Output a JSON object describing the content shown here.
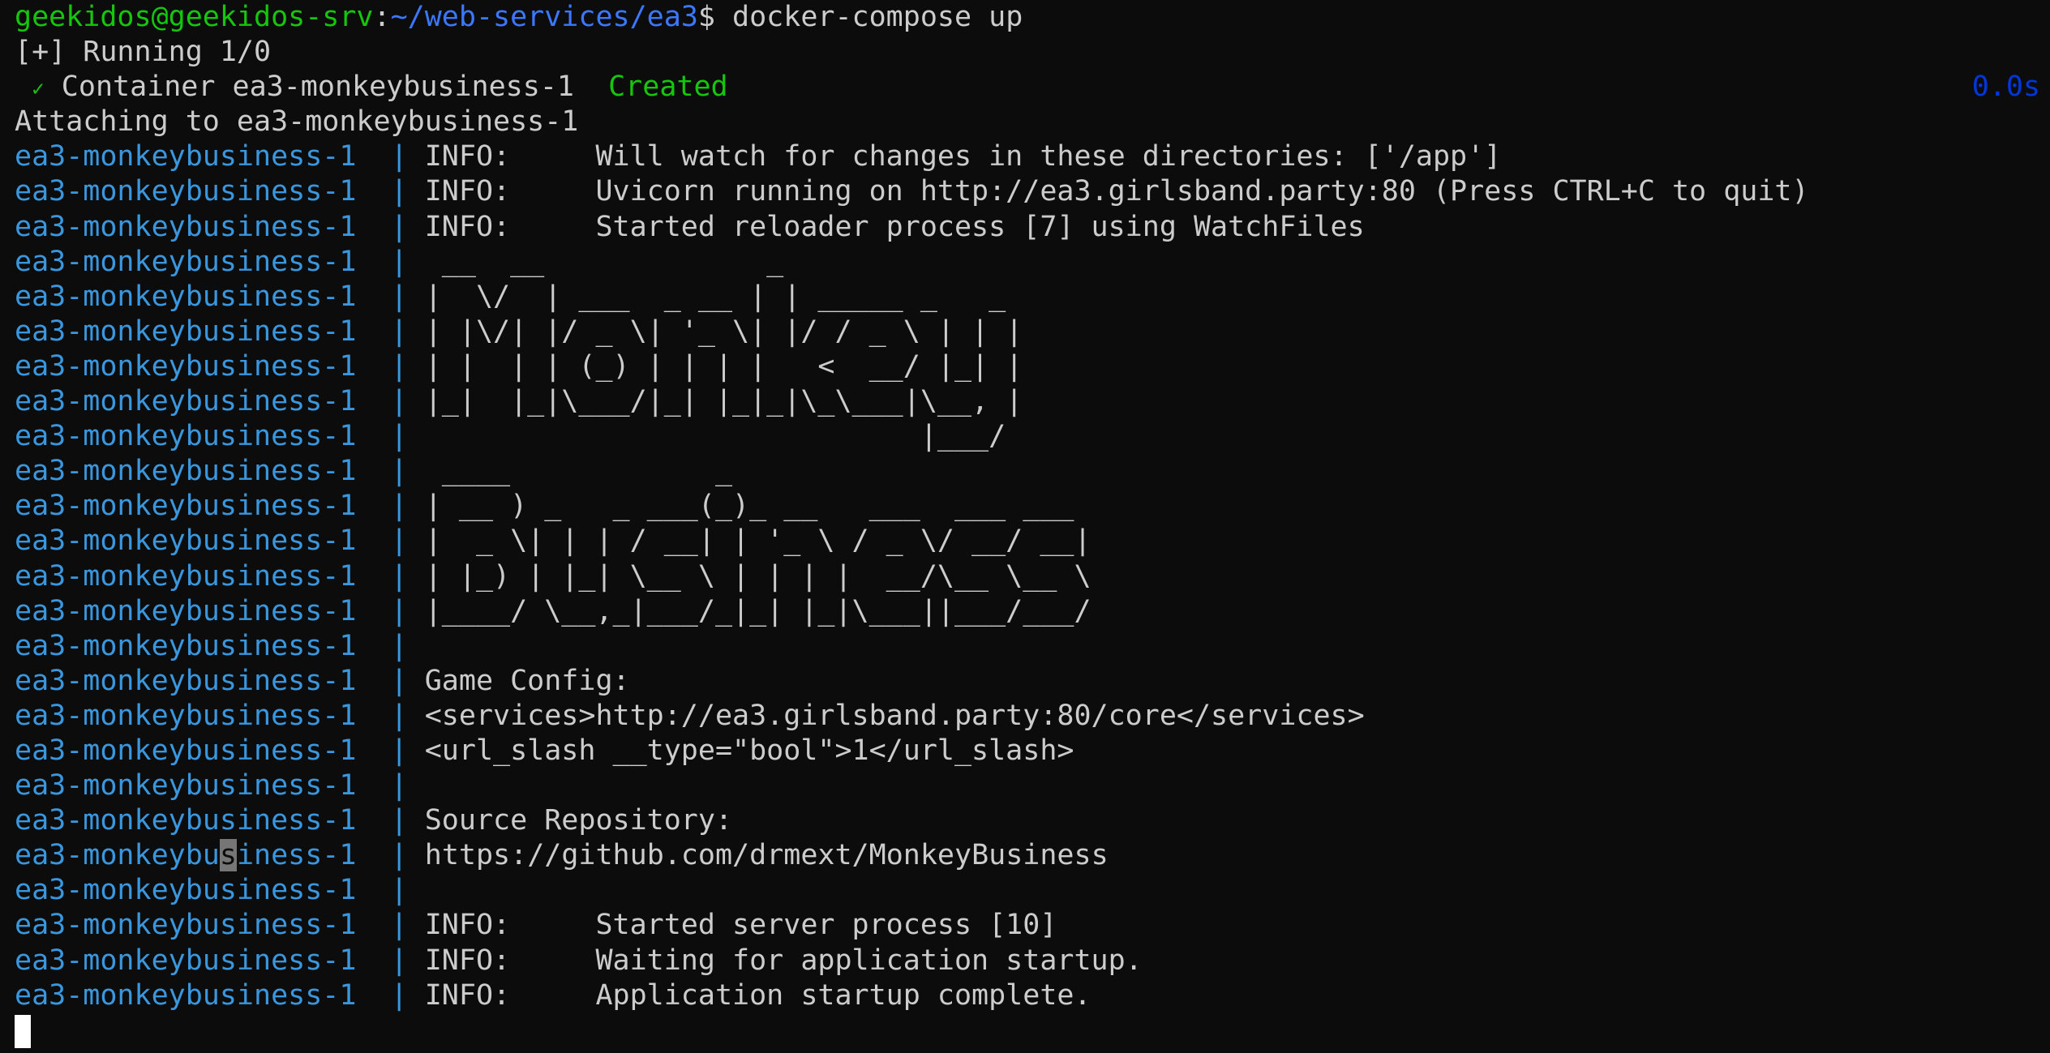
{
  "prompt": {
    "user_host": "geekidos@geekidos-srv",
    "separator": ":",
    "path": "~/web-services/ea3",
    "symbol": "$",
    "command": " docker-compose up"
  },
  "compose": {
    "running": "[+] Running 1/0",
    "check_glyph": "✓",
    "container_text": " Container ea3-monkeybusiness-1  ",
    "container_status": "Created",
    "duration": "0.0s",
    "attaching": "Attaching to ea3-monkeybusiness-1"
  },
  "service_prefix": "ea3-monkeybusiness-1",
  "service_prefix_parts": [
    "ea3-monkeybu",
    "s",
    "iness-1"
  ],
  "pipe": "  | ",
  "log_lines": [
    "INFO:     Will watch for changes in these directories: ['/app']",
    "INFO:     Uvicorn running on http://ea3.girlsband.party:80 (Press CTRL+C to quit)",
    "INFO:     Started reloader process [7] using WatchFiles",
    " __  __             _",
    "|  \\/  | ___  _ __ | | _____ _   _",
    "| |\\/| |/ _ \\| '_ \\| |/ / _ \\ | | |",
    "| |  | | (_) | | | |   <  __/ |_| |",
    "|_|  |_|\\___/|_| |_|_|\\_\\___|\\__, |",
    "                             |___/",
    " ____            _",
    "| __ ) _   _ ___(_)_ __   ___  ___ ___",
    "|  _ \\| | | / __| | '_ \\ / _ \\/ __/ __|",
    "| |_) | |_| \\__ \\ | | | |  __/\\__ \\__ \\",
    "|____/ \\__,_|___/_|_| |_|\\___||___/___/",
    "",
    "Game Config:",
    "<services>http://ea3.girlsband.party:80/core</services>",
    "<url_slash __type=\"bool\">1</url_slash>",
    "",
    "Source Repository:",
    "https://github.com/drmext/MonkeyBusiness",
    "",
    "INFO:     Started server process [10]",
    "INFO:     Waiting for application startup.",
    "INFO:     Application startup complete."
  ],
  "colors": {
    "background": "#0c0c0c",
    "foreground": "#cccccc",
    "prompt_green": "#16c60c",
    "prompt_blue": "#3b78ff",
    "service_blue": "#3a96dd",
    "duration_blue": "#0037da"
  }
}
